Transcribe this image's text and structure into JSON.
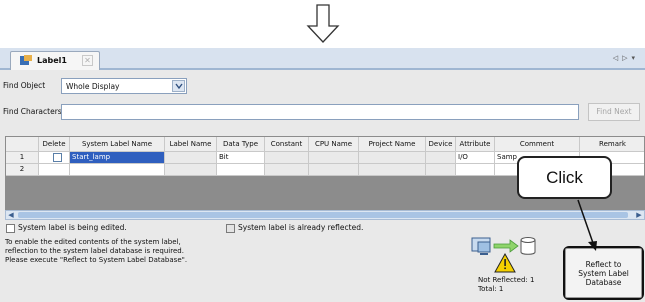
{
  "tab": {
    "label": "Label1",
    "close": "✕",
    "nav": "◁▷▾"
  },
  "find": {
    "object_label": "Find Object",
    "object_value": "Whole Display",
    "characters_label": "Find Characters",
    "characters_value": "",
    "find_next": "Find Next"
  },
  "table": {
    "columns": [
      "",
      "Delete",
      "System Label Name",
      "Label Name",
      "Data Type",
      "Constant",
      "CPU Name",
      "Project Name",
      "Device",
      "Attribute",
      "Comment",
      "Remark"
    ],
    "rows": [
      {
        "num": "1",
        "system_label_name": "Start_lamp",
        "label_name": "",
        "data_type": "Bit",
        "constant": "",
        "cpu_name": "",
        "project_name": "",
        "device": "",
        "attribute": "I/O",
        "comment": "Samp",
        "remark": ""
      },
      {
        "num": "2",
        "system_label_name": "",
        "label_name": "",
        "data_type": "",
        "constant": "",
        "cpu_name": "",
        "project_name": "",
        "device": "",
        "attribute": "",
        "comment": "",
        "remark": ""
      }
    ]
  },
  "status": {
    "editing": "System label is being edited.",
    "reflected": "System label is already reflected."
  },
  "message": [
    "To enable the edited contents of the system label,",
    "reflection to the system label database is required.",
    "Please execute \"Reflect to System Label Database\"."
  ],
  "counts": {
    "not_reflected": "Not Reflected: 1",
    "total": "Total: 1"
  },
  "reflect_button": [
    "Reflect to",
    "System Label",
    "Database"
  ],
  "callout": "Click"
}
